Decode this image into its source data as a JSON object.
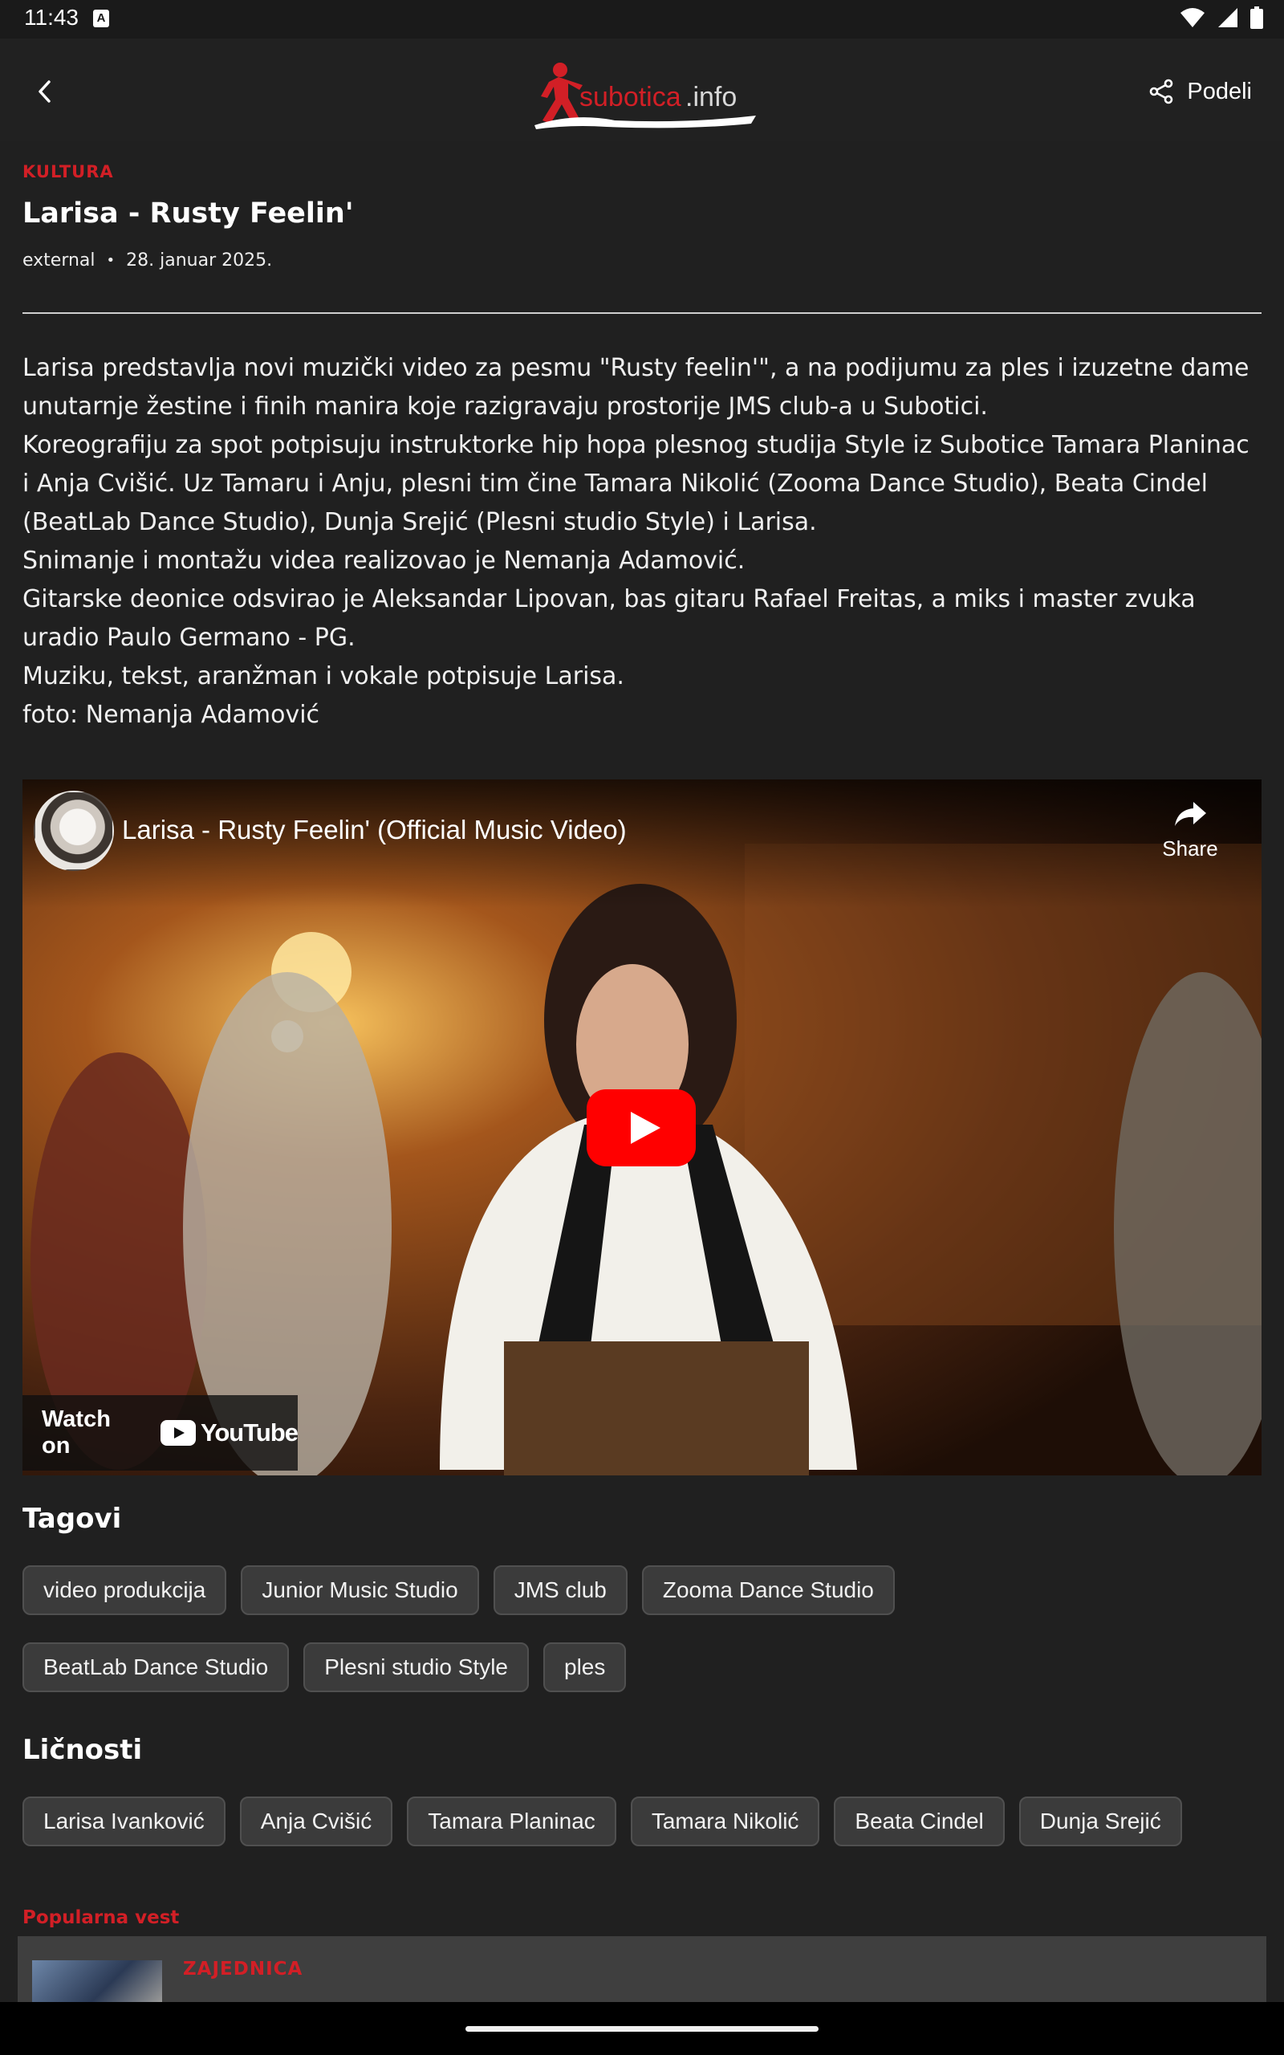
{
  "status_bar": {
    "time": "11:43",
    "notification_icon": "a-icon",
    "icons": [
      "wifi-icon",
      "signal-icon",
      "battery-icon"
    ]
  },
  "app_bar": {
    "back_icon": "arrow-left-icon",
    "logo_text": "subotica.info",
    "share_label": "Podeli",
    "share_icon": "share-icon"
  },
  "article": {
    "category": "KULTURA",
    "title": "Larisa - Rusty Feelin'",
    "author": "external",
    "separator": "•",
    "date": "28. januar 2025.",
    "body": "Larisa predstavlja novi muzički video za pesmu \"Rusty feelin'\", a na podijumu za ples i izuzetne dame unutarnje žestine i finih manira koje razigravaju prostorije JMS club-a u Subotici.\nKoreografiju za spot potpisuju instruktorke hip hopa plesnog studija Style iz Subotice Tamara Planinac i Anja Cvišić. Uz Tamaru i Anju, plesni tim čine Tamara Nikolić (Zooma Dance Studio), Beata Cindel (BeatLab Dance Studio), Dunja Srejić (Plesni studio Style) i Larisa.\nSnimanje i montažu videa realizovao je Nemanja Adamović.\nGitarske deonice odsvirao je Aleksandar Lipovan, bas gitaru Rafael Freitas, a miks i master zvuka uradio Paulo Germano - PG.\nMuziku, tekst, aranžman i vokale potpisuje Larisa.\nfoto: Nemanja Adamović"
  },
  "video": {
    "title": "Larisa - Rusty Feelin' (Official Music Video)",
    "share_label": "Share",
    "watch_on_label": "Watch on",
    "youtube_label": "YouTube"
  },
  "tags": {
    "heading": "Tagovi",
    "rows": [
      [
        "video produkcija",
        "Junior Music Studio",
        "JMS club",
        "Zooma Dance Studio"
      ],
      [
        "BeatLab Dance Studio",
        "Plesni studio Style",
        "ples"
      ]
    ]
  },
  "persons": {
    "heading": "Ličnosti",
    "items": [
      "Larisa Ivanković",
      "Anja Cvišić",
      "Tamara Planinac",
      "Tamara Nikolić",
      "Beata Cindel",
      "Dunja Srejić"
    ]
  },
  "popular": {
    "label": "Popularna vest",
    "category": "ZAJEDNICA"
  },
  "colors": {
    "accent": "#d21f26",
    "background": "#202020",
    "chip": "#3b3b3b",
    "youtube_red": "#ff0000"
  }
}
